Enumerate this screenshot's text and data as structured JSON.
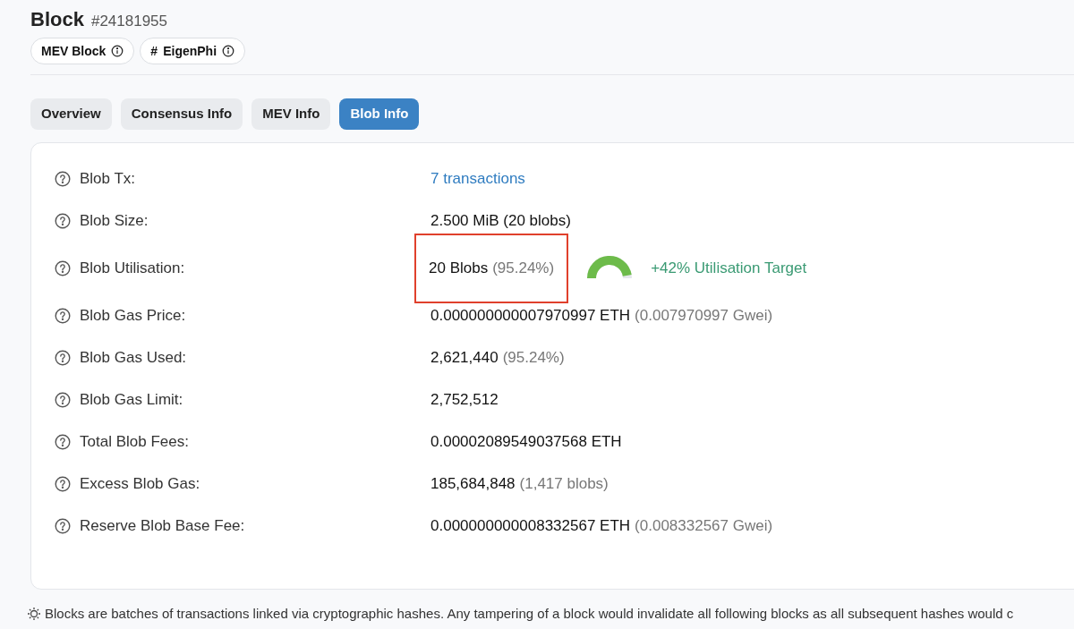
{
  "header": {
    "title": "Block",
    "number": "#24181955",
    "badges": [
      {
        "label": "MEV Block"
      },
      {
        "label": "EigenPhi",
        "prefix": "#"
      }
    ]
  },
  "tabs": [
    {
      "label": "Overview",
      "selected": false
    },
    {
      "label": "Consensus Info",
      "selected": false
    },
    {
      "label": "MEV Info",
      "selected": false
    },
    {
      "label": "Blob Info",
      "selected": true
    }
  ],
  "rows": [
    {
      "kind": "link",
      "label": "Blob Tx:",
      "value": "7 transactions"
    },
    {
      "kind": "text",
      "label": "Blob Size:",
      "value": "2.500 MiB (20 blobs)"
    },
    {
      "kind": "gauge",
      "label": "Blob Utilisation:",
      "value": "20 Blobs",
      "note": "(95.24%)",
      "highlighted": true,
      "level": 0.95,
      "target": "+42% Utilisation Target"
    },
    {
      "kind": "text",
      "label": "Blob Gas Price:",
      "value": "0.000000000007970997 ETH",
      "note": "(0.007970997 Gwei)"
    },
    {
      "kind": "text",
      "label": "Blob Gas Used:",
      "value": "2,621,440",
      "note": "(95.24%)"
    },
    {
      "kind": "text",
      "label": "Blob Gas Limit:",
      "value": "2,752,512"
    },
    {
      "kind": "text",
      "label": "Total Blob Fees:",
      "value": "0.00002089549037568 ETH"
    },
    {
      "kind": "text",
      "label": "Excess Blob Gas:",
      "value": "185,684,848",
      "note": "(1,417 blobs)"
    },
    {
      "kind": "text",
      "label": "Reserve Blob Base Fee:",
      "value": "0.000000000008332567 ETH",
      "note": "(0.008332567 Gwei)"
    }
  ],
  "footer_note": "Blocks are batches of transactions linked via cryptographic hashes. Any tampering of a block would invalidate all following blocks as all subsequent hashes would c"
}
